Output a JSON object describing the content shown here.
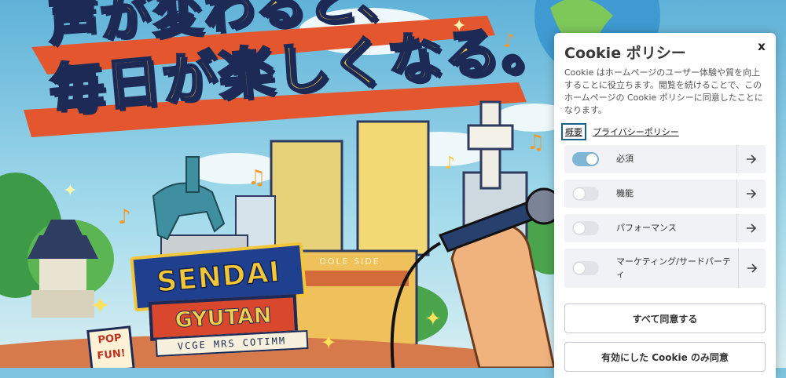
{
  "hero": {
    "headline_line1": "声が変わると、",
    "headline_line2": "毎日が楽しくなる。",
    "sign_sendai": "SENDAI",
    "sign_gyutan": "GYUTAN",
    "sign_pop": "POP FUN!",
    "sign_strip": "VCGE MRS COTIMM",
    "sign_stadium": "OOLE SIDE"
  },
  "cookie": {
    "title": "Cookie ポリシー",
    "close_label": "x",
    "description": "Cookie はホームページのユーザー体験や質を向上することに役立ちます。閲覧を続けることで、このホームページの Cookie ポリシーに同意したことになります。",
    "tab_overview": "概要",
    "privacy_link": "プライバシーポリシー",
    "categories": [
      {
        "label": "必須",
        "enabled": true
      },
      {
        "label": "機能",
        "enabled": false
      },
      {
        "label": "パフォーマンス",
        "enabled": false
      },
      {
        "label": "マーケティング/サードパーティ",
        "enabled": false
      }
    ],
    "arrow_icon": "→",
    "accept_all": "すべて同意する",
    "accept_selected": "有効にした Cookie のみ同意"
  },
  "colors": {
    "toggle_on": "#7fb6d6",
    "toggle_off": "#e1e3e8",
    "row_bg": "#f1f2f5",
    "link_focus_border": "#1a5f8a"
  }
}
